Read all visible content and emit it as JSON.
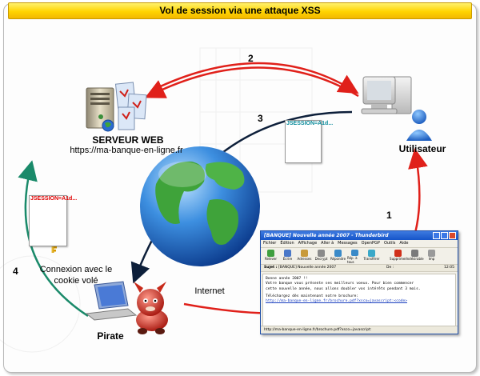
{
  "title": "Vol de session via une attaque XSS",
  "server": {
    "name": "SERVEUR WEB",
    "url": "https://ma-banque-en-ligne.fr"
  },
  "user": {
    "label": "Utilisateur"
  },
  "pirate": {
    "label": "Pirate"
  },
  "internet": {
    "label": "Internet"
  },
  "stolen_cookie": {
    "line1": "Connexion avec le",
    "line2": "cookie volé",
    "token": "JSESSION=A1d..."
  },
  "user_cookie": {
    "token": "JSESSION=A1d..."
  },
  "steps": {
    "one": "1",
    "two": "2",
    "three": "3",
    "four": "4"
  },
  "mail_window": {
    "title": "[BANQUE] Nouvelle année 2007 - Thunderbird",
    "menu": [
      "Fichier",
      "Édition",
      "Affichage",
      "Aller à",
      "Messages",
      "OpenPGP",
      "Outils",
      "Aide"
    ],
    "toolbar": [
      "Relever",
      "Écrire",
      "Adresses",
      "Decrypt",
      "Répondre",
      "Rép. à tous",
      "Transférer",
      "Supprimer",
      "Indésirable",
      "Imp"
    ],
    "subject_label": "Sujet :",
    "subject": "[BANQUE] Nouvelle année 2007",
    "from_label": "De :",
    "time": "12:05",
    "body_line1": "Bonne année 2007 !!",
    "body_line2": "Votre banque vous présente ses meilleurs voeux. Pour bien commencer",
    "body_line3": "cette nouvelle année, nous allons doubler vos intérêts pendant 3 mois.",
    "body_line4": "Téléchargez dès maintenant notre brochure:",
    "body_link": "http://ma-banque-en-ligne.fr/brochure.pdf?xsco=javascript:<code>",
    "status": "http://ma-banque-en-ligne.fr/brochure.pdf?xsco=javascript:"
  },
  "colors": {
    "title_bar": "#ffd400",
    "red_arrow": "#e0201a",
    "dark_arrow": "#0d1f3a",
    "teal_arrow": "#1a8a6a"
  }
}
